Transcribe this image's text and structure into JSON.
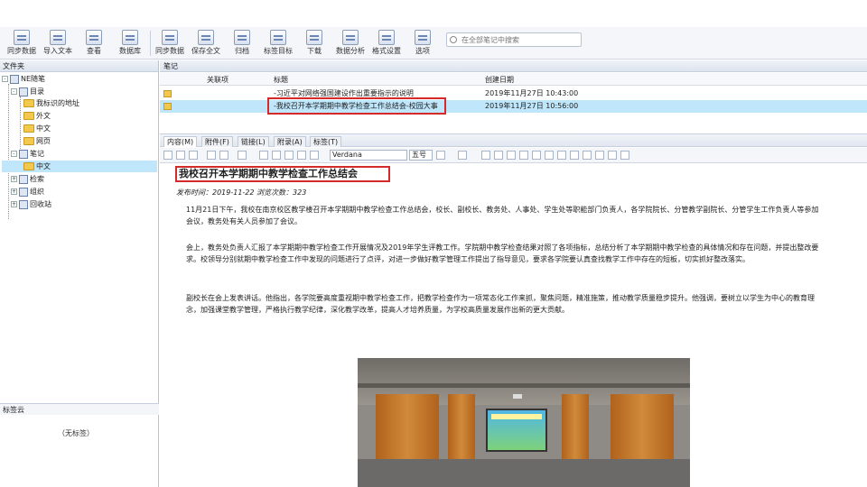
{
  "toolbar": {
    "buttons": [
      "同步数据",
      "导入文本",
      "查看",
      "数据库",
      "同步数据",
      "保存全文",
      "归档",
      "标签目标",
      "下载",
      "数据分析",
      "格式设置",
      "选项"
    ],
    "search_placeholder": "在全部笔记中搜索"
  },
  "left": {
    "title": "文件夹",
    "tree": [
      "NE随笔",
      "目录",
      "我标识的地址",
      "外文",
      "中文",
      "网页",
      "笔记",
      "中文",
      "检索",
      "组织",
      "回收站"
    ],
    "tag_title": "标签云",
    "tag_empty": "（无标签）"
  },
  "list": {
    "tab": "笔记",
    "headers": {
      "attachment": "关联项",
      "title": "标题",
      "date": "创建日期"
    },
    "rows": [
      {
        "title": "-习近平对网络强国建设作出重要指示的说明",
        "date": "2019年11月27日 10:43:00"
      },
      {
        "title": "-我校召开本学期期中教学检查工作总结会-校园大事",
        "date": "2019年11月27日 10:56:00"
      }
    ]
  },
  "editor": {
    "tabs": [
      "内容(M)",
      "附件(F)",
      "链接(L)",
      "附录(A)",
      "标签(T)"
    ],
    "font_name": "Verdana",
    "font_size": "五号",
    "title": "我校召开本学期期中教学检查工作总结会",
    "meta": "发布时间：2019-11-22 浏览次数：323",
    "paragraphs": [
      "11月21日下午，我校在南京校区教学楼召开本学期期中教学检查工作总结会，校长、副校长、教务处、人事处、学生处等职能部门负责人，各学院院长、分管教学副院长、分管学生工作负责人等参加会议，教务处有关人员参加了会议。",
      "会上，教务处负责人汇报了本学期期中教学检查工作开展情况及2019年学生评教工作。学院期中教学检查结果对照了各项指标，总结分析了本学期期中教学检查的具体情况和存在问题，并提出整改要求。校领导分别就期中教学检查工作中发现的问题进行了点评，对进一步做好教学管理工作提出了指导意见，要求各学院要认真查找教学工作中存在的短板，切实抓好整改落实。",
      "副校长在会上发表讲话。他指出，各学院要高度重视期中教学检查工作，把教学检查作为一项常态化工作来抓，聚焦问题，精准施策，推动教学质量稳步提升。他强调，要树立以学生为中心的教育理念，加强课堂教学管理，严格执行教学纪律，深化教学改革，提高人才培养质量，为学校高质量发展作出新的更大贡献。"
    ]
  }
}
